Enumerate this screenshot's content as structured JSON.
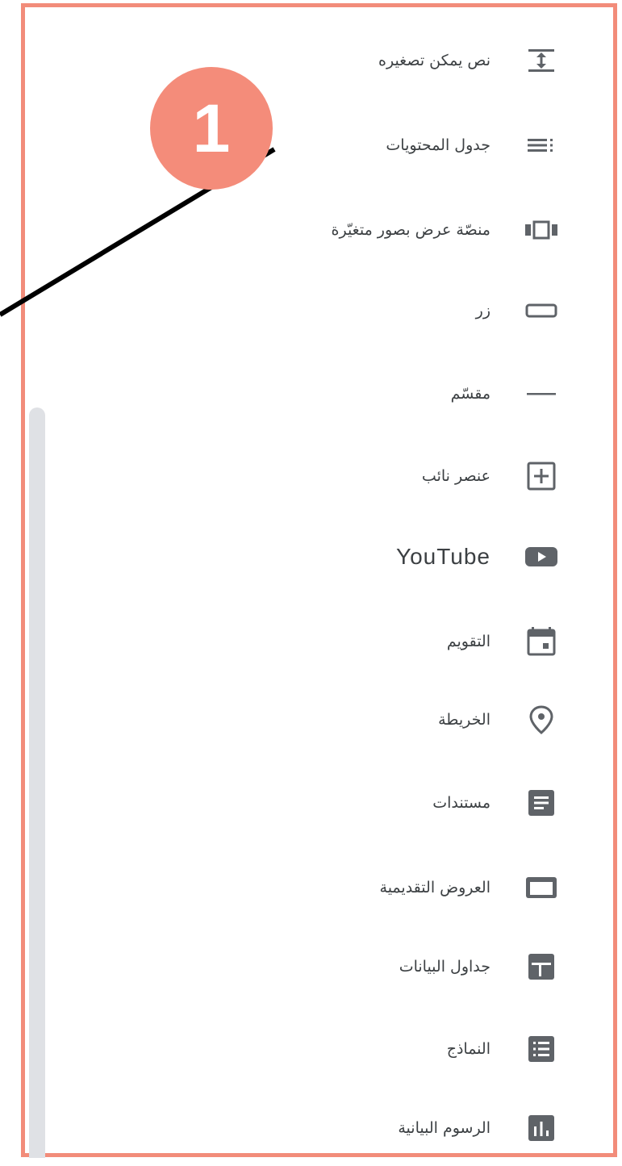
{
  "menu": {
    "items": [
      {
        "label": "نص يمكن تصغيره",
        "icon": "collapsible-text-icon"
      },
      {
        "label": "جدول المحتويات",
        "icon": "table-of-contents-icon"
      },
      {
        "label": "منصّة عرض بصور متغيّرة",
        "icon": "carousel-icon"
      },
      {
        "label": "زر",
        "icon": "button-icon"
      },
      {
        "label": "مقسّم",
        "icon": "divider-icon"
      },
      {
        "label": "عنصر نائب",
        "icon": "placeholder-icon"
      },
      {
        "label": "YouTube",
        "icon": "youtube-icon"
      },
      {
        "label": "التقويم",
        "icon": "calendar-icon"
      },
      {
        "label": "الخريطة",
        "icon": "map-pin-icon"
      },
      {
        "label": "مستندات",
        "icon": "docs-icon"
      },
      {
        "label": "العروض التقديمية",
        "icon": "slides-icon"
      },
      {
        "label": "جداول البيانات",
        "icon": "sheets-icon"
      },
      {
        "label": "النماذج",
        "icon": "forms-icon"
      },
      {
        "label": "الرسوم البيانية",
        "icon": "charts-icon"
      }
    ]
  },
  "callout": {
    "number": "1"
  },
  "colors": {
    "frame": "#f28c7a",
    "badge": "#f48c7a",
    "icon": "#5f6368",
    "text": "#3c4043"
  }
}
